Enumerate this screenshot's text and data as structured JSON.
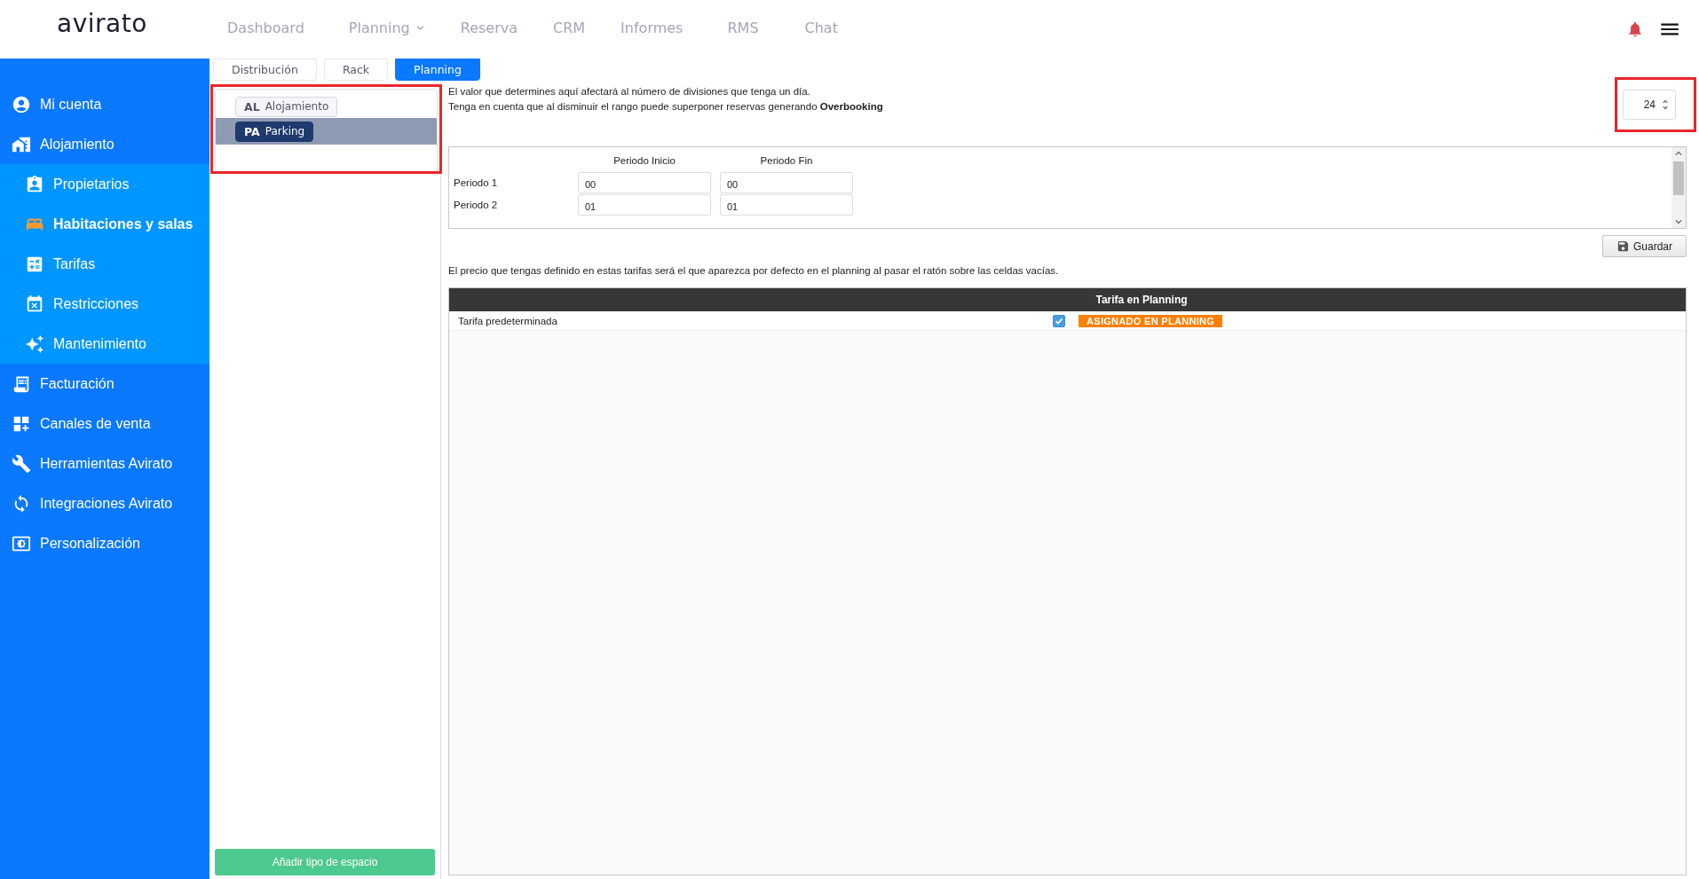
{
  "header": {
    "logo": "avirato",
    "nav": [
      {
        "label": "Dashboard",
        "dropdown": false
      },
      {
        "label": "Planning",
        "dropdown": true
      },
      {
        "label": "Reserva",
        "dropdown": false
      },
      {
        "label": "CRM",
        "dropdown": false
      },
      {
        "label": "Informes",
        "dropdown": false
      },
      {
        "label": "RMS",
        "dropdown": false
      },
      {
        "label": "Chat",
        "dropdown": false
      }
    ]
  },
  "sidebar": {
    "items": [
      {
        "label": "Mi cuenta"
      },
      {
        "label": "Alojamiento",
        "expanded": true,
        "children": [
          {
            "label": "Propietarios",
            "selected": false
          },
          {
            "label": "Habitaciones y salas",
            "selected": true
          },
          {
            "label": "Tarifas",
            "selected": false
          },
          {
            "label": "Restricciones",
            "selected": false
          },
          {
            "label": "Mantenimiento",
            "selected": false
          }
        ]
      },
      {
        "label": "Facturación"
      },
      {
        "label": "Canales de venta"
      },
      {
        "label": "Herramientas Avirato"
      },
      {
        "label": "Integraciones Avirato"
      },
      {
        "label": "Personalización"
      }
    ]
  },
  "tabs": [
    {
      "label": "Distribución",
      "selected": false
    },
    {
      "label": "Rack",
      "selected": false
    },
    {
      "label": "Planning",
      "selected": true
    }
  ],
  "space_types": {
    "highlighted": true,
    "items": [
      {
        "code": "AL",
        "label": "Alojamiento",
        "selected": false
      },
      {
        "code": "PA",
        "label": "Parking",
        "selected": true
      }
    ],
    "add_button": "Añadir tipo de espacio"
  },
  "divisions": {
    "notes": [
      "El valor que determines aquí afectará al número de divisiones que tenga un día.",
      "Tenga en cuenta que al disminuir el rango puede superponer reservas generando **Overbooking**"
    ],
    "value": "24",
    "highlighted": true
  },
  "periods": {
    "columns": [
      "Periodo Inicio",
      "Periodo Fin"
    ],
    "rows": [
      {
        "label": "Periodo 1",
        "start": "00",
        "end": "00"
      },
      {
        "label": "Periodo 2",
        "start": "01",
        "end": "01"
      }
    ]
  },
  "save_button": "Guardar",
  "rates": {
    "note": "El precio que tengas definido en estas tarifas será el que aparezca por defecto en el planning al pasar el ratón sobre las celdas vacías.",
    "header": "Tarifa en Planning",
    "rows": [
      {
        "name": "Tarifa predeterminada",
        "checked": true,
        "badge": "ASIGNADO EN PLANNING"
      }
    ]
  }
}
